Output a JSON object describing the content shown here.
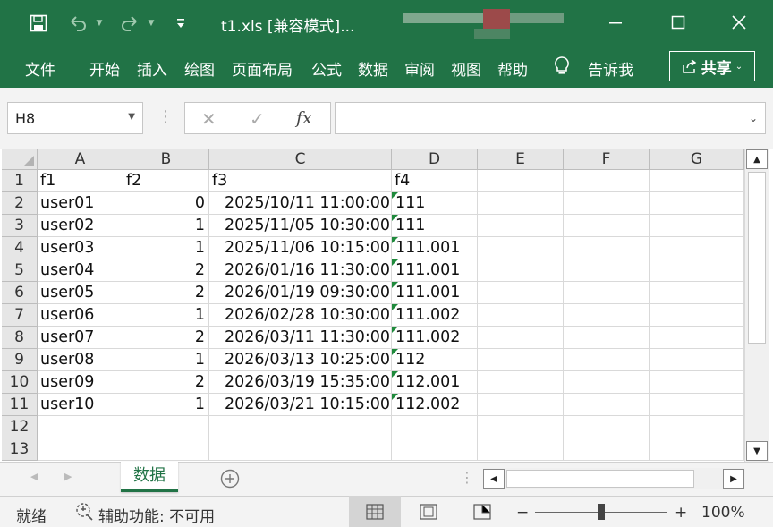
{
  "titlebar": {
    "title": "t1.xls  [兼容模式]...",
    "icons": [
      "save-icon",
      "undo-icon",
      "redo-icon",
      "customize-icon",
      "minimize-icon",
      "maximize-icon",
      "close-icon"
    ]
  },
  "ribbon": {
    "tabs": [
      "文件",
      "开始",
      "插入",
      "绘图",
      "页面布局",
      "公式",
      "数据",
      "审阅",
      "视图",
      "帮助"
    ],
    "tell_me": "告诉我",
    "share": "共享"
  },
  "formula": {
    "name_box": "H8",
    "fx_label": "fx",
    "content": ""
  },
  "grid": {
    "columns": [
      "A",
      "B",
      "C",
      "D",
      "E",
      "F",
      "G"
    ],
    "row_numbers": [
      "1",
      "2",
      "3",
      "4",
      "5",
      "6",
      "7",
      "8",
      "9",
      "10",
      "11",
      "12",
      "13"
    ],
    "rows": [
      [
        "f1",
        "f2",
        "f3",
        "f4"
      ],
      [
        "user01",
        "0",
        "2025/10/11 11:00:00",
        "111"
      ],
      [
        "user02",
        "1",
        "2025/11/05 10:30:00",
        "111"
      ],
      [
        "user03",
        "1",
        "2025/11/06 10:15:00",
        "111.001"
      ],
      [
        "user04",
        "2",
        "2026/01/16 11:30:00",
        "111.001"
      ],
      [
        "user05",
        "2",
        "2026/01/19 09:30:00",
        "111.001"
      ],
      [
        "user06",
        "1",
        "2026/02/28 10:30:00",
        "111.002"
      ],
      [
        "user07",
        "2",
        "2026/03/11 11:30:00",
        "111.002"
      ],
      [
        "user08",
        "1",
        "2026/03/13 10:25:00",
        "112"
      ],
      [
        "user09",
        "2",
        "2026/03/19 15:35:00",
        "112.001"
      ],
      [
        "user10",
        "1",
        "2026/03/21 10:15:00",
        "112.002"
      ],
      [
        "",
        "",
        "",
        ""
      ],
      [
        "",
        "",
        "",
        ""
      ]
    ]
  },
  "sheets": {
    "active": "数据"
  },
  "status": {
    "ready": "就绪",
    "accessibility": "辅助功能: 不可用",
    "zoom": "100%",
    "minus": "−",
    "plus": "+"
  },
  "colors": {
    "accent": "#217346",
    "error_triangle": "#1f8a3c"
  }
}
